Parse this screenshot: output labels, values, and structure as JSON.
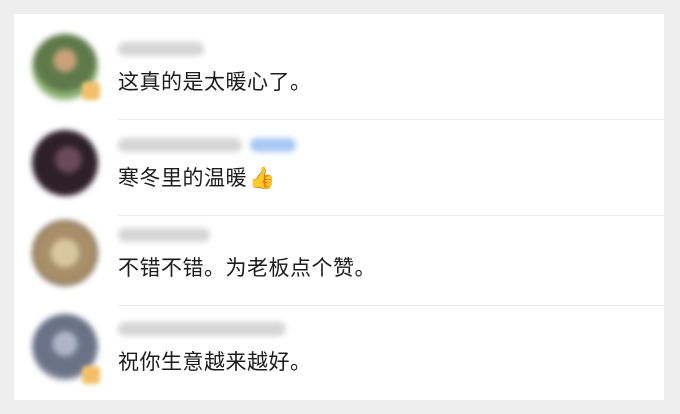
{
  "comments": [
    {
      "text": "这真的是太暖心了。",
      "avatar_color": "#6f8f5a"
    },
    {
      "text": "寒冬里的温暖",
      "emoji": "👍",
      "avatar_color": "#3a2a35"
    },
    {
      "text": "不错不错。为老板点个赞。",
      "avatar_color": "#b9a27a"
    },
    {
      "text": "祝你生意越来越好。",
      "avatar_color": "#6a7287"
    }
  ],
  "colors": {
    "background": "#eeeeee",
    "panel": "#ffffff",
    "text": "#1c1c1c",
    "blurred_name": "#d6d6d6",
    "blurred_tag": "#a9c8f5"
  }
}
